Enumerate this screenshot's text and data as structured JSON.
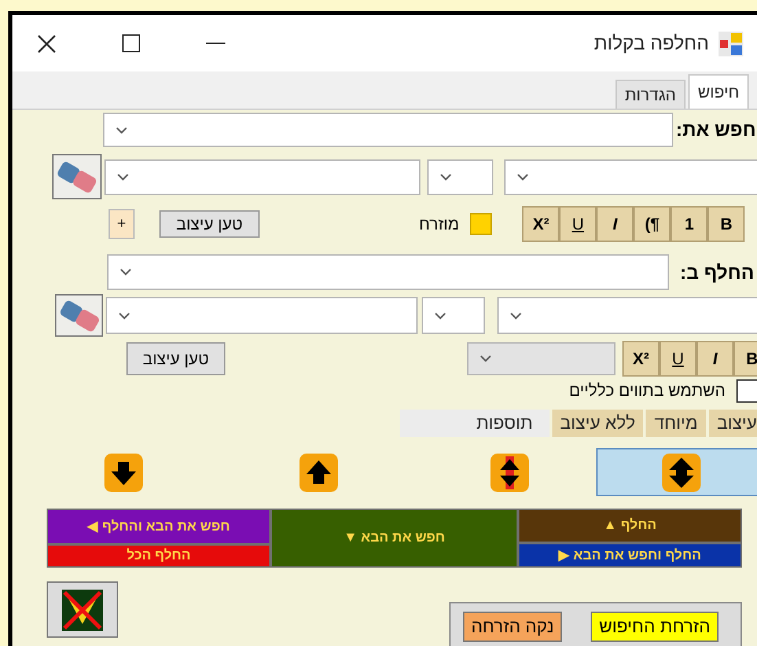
{
  "window": {
    "title": "החלפה בקלות"
  },
  "tabs": [
    {
      "label": "חיפוש",
      "selected": true
    },
    {
      "label": "הגדרות",
      "selected": false
    }
  ],
  "find": {
    "label": "חפש את:",
    "highlight_label": "מוזרח",
    "load_format_button": "טען עיצוב",
    "add_button": "+",
    "format_buttons": [
      {
        "label": "B",
        "kind": "bold"
      },
      {
        "label": "1",
        "kind": "bold"
      },
      {
        "label": "(¶",
        "kind": "bold"
      },
      {
        "label": "I",
        "kind": "italic"
      },
      {
        "label": "U",
        "kind": "underline"
      },
      {
        "label": "X²",
        "kind": "superscript"
      }
    ]
  },
  "replace": {
    "label": "החלף ב:",
    "load_format_button": "טען עיצוב",
    "format_buttons": [
      {
        "label": "B",
        "kind": "bold"
      },
      {
        "label": "I",
        "kind": "italic"
      },
      {
        "label": "U",
        "kind": "underline"
      },
      {
        "label": "X²",
        "kind": "superscript"
      }
    ]
  },
  "wildcards": {
    "label": "השתמש בתווים כלליים",
    "checked": false
  },
  "sub_tabs": [
    {
      "label": "עיצוב",
      "selected": false
    },
    {
      "label": "מיוחד",
      "selected": false
    },
    {
      "label": "ללא עיצוב",
      "selected": false
    },
    {
      "label": "תוספות",
      "selected": true
    }
  ],
  "direction_buttons": [
    {
      "kind": "both",
      "selected": true
    },
    {
      "kind": "both-red",
      "selected": false
    },
    {
      "kind": "up",
      "selected": false
    },
    {
      "kind": "down",
      "selected": false
    }
  ],
  "actions": {
    "replace": {
      "label": "החלף ▲",
      "color": "#58360a"
    },
    "replace_find_next": {
      "label": "החלף וחפש את הבא ▶",
      "color": "#0a33a8"
    },
    "find_next": {
      "label": "חפש את הבא ▼",
      "color": "#375f00"
    },
    "find_next_replace": {
      "label": "חפש את הבא והחלף ◀",
      "color": "#7a0db3"
    },
    "replace_all": {
      "label": "החלף הכל",
      "color": "#e60b0b"
    }
  },
  "highlight": {
    "buttons": [
      {
        "label": "הזרחת החיפוש",
        "color": "#ffff00"
      },
      {
        "label": "נקה הזרחה",
        "color": "#f5a35a"
      }
    ]
  }
}
